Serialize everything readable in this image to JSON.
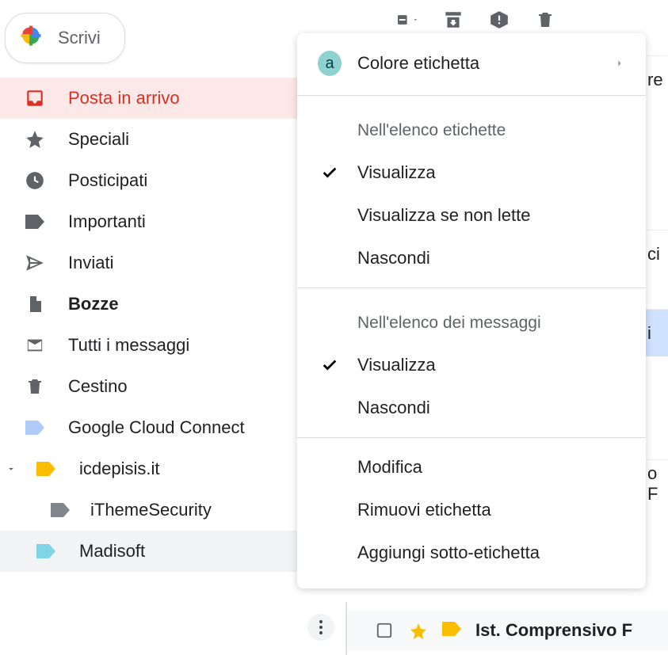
{
  "compose": {
    "label": "Scrivi"
  },
  "sidebar": {
    "items": [
      {
        "label": "Posta in arrivo"
      },
      {
        "label": "Speciali"
      },
      {
        "label": "Posticipati"
      },
      {
        "label": "Importanti"
      },
      {
        "label": "Inviati"
      },
      {
        "label": "Bozze"
      },
      {
        "label": "Tutti i messaggi"
      },
      {
        "label": "Cestino"
      },
      {
        "label": "Google Cloud Connect"
      },
      {
        "label": "icdepisis.it"
      },
      {
        "label": "iThemeSecurity"
      },
      {
        "label": "Madisoft"
      }
    ],
    "label_colors": {
      "google_cloud": "#aecbfa",
      "icdepisis": "#fbbc04",
      "itheme": "#80868b",
      "madisoft": "#81d4e6"
    }
  },
  "menu": {
    "color_badge_letter": "a",
    "color_label": "Colore etichetta",
    "section1_title": "Nell'elenco etichette",
    "section1_items": [
      "Visualizza",
      "Visualizza se non lette",
      "Nascondi"
    ],
    "section2_title": "Nell'elenco dei messaggi",
    "section2_items": [
      "Visualizza",
      "Nascondi"
    ],
    "section3_items": [
      "Modifica",
      "Rimuovi etichetta",
      "Aggiungi sotto-etichetta"
    ]
  },
  "peek_row": {
    "sender": "Ist. Comprensivo F"
  },
  "partial_right": {
    "r1": "re",
    "r2": "ci",
    "r3": "i",
    "r4": "o F"
  }
}
